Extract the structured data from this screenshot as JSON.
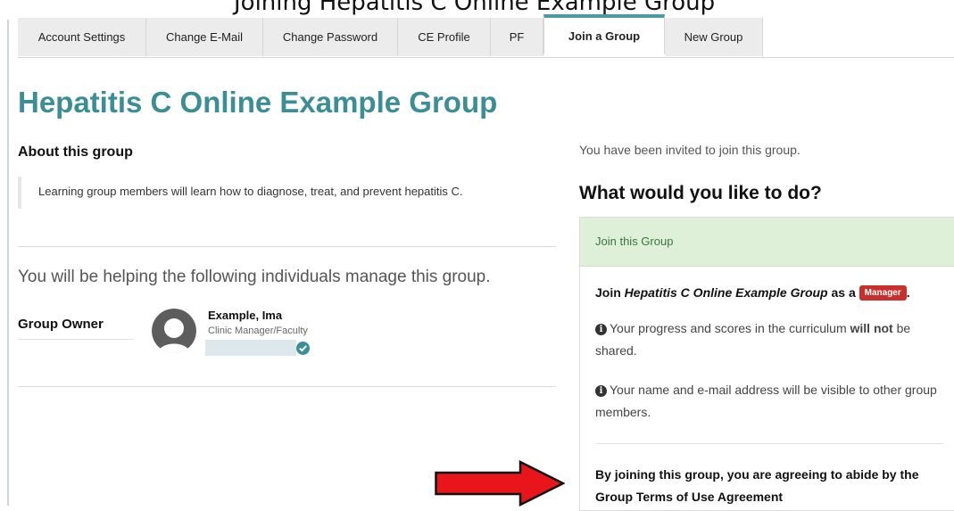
{
  "top_caption": "Joining Hepatitis C Online Example Group",
  "tabs": [
    {
      "label": "Account Settings",
      "active": false
    },
    {
      "label": "Change E-Mail",
      "active": false
    },
    {
      "label": "Change Password",
      "active": false
    },
    {
      "label": "CE Profile",
      "active": false
    },
    {
      "label": "PF",
      "active": false
    },
    {
      "label": "Join a Group",
      "active": true
    },
    {
      "label": "New Group",
      "active": false
    }
  ],
  "page_title": "Hepatitis C Online Example Group",
  "about": {
    "heading": "About this group",
    "description": "Learning group members will learn how to diagnose, treat, and prevent hepatitis C."
  },
  "helping_text": "You will be helping the following individuals manage this group.",
  "owner": {
    "label": "Group Owner",
    "name": "Example, Ima",
    "role": "Clinic Manager/Faculty"
  },
  "invite": {
    "message": "You have been invited to join this group.",
    "question": "What would you like to do?"
  },
  "join_card": {
    "header": "Join this Group",
    "join_prefix": "Join ",
    "group_name": "Hepatitis C Online Example Group",
    "join_as": " as a ",
    "role_badge": "Manager",
    "join_suffix": ".",
    "progress_pre": "Your progress and scores in the curriculum ",
    "progress_bold": "will not",
    "progress_post": " be shared.",
    "visibility": "Your name and e-mail address will be visible to other group members.",
    "agreement": "By joining this group, you are agreeing to abide by the Group Terms of Use Agreement"
  },
  "icons": {
    "info": "info-circle-icon",
    "avatar": "user-avatar-icon",
    "verified": "check-circle-icon",
    "arrow": "red-right-arrow-icon"
  },
  "colors": {
    "title_teal": "#3b8d96",
    "success_bg": "#dff0d8",
    "success_text": "#3c763d",
    "manager_badge": "#c9302c",
    "arrow_red": "#e8161b"
  }
}
